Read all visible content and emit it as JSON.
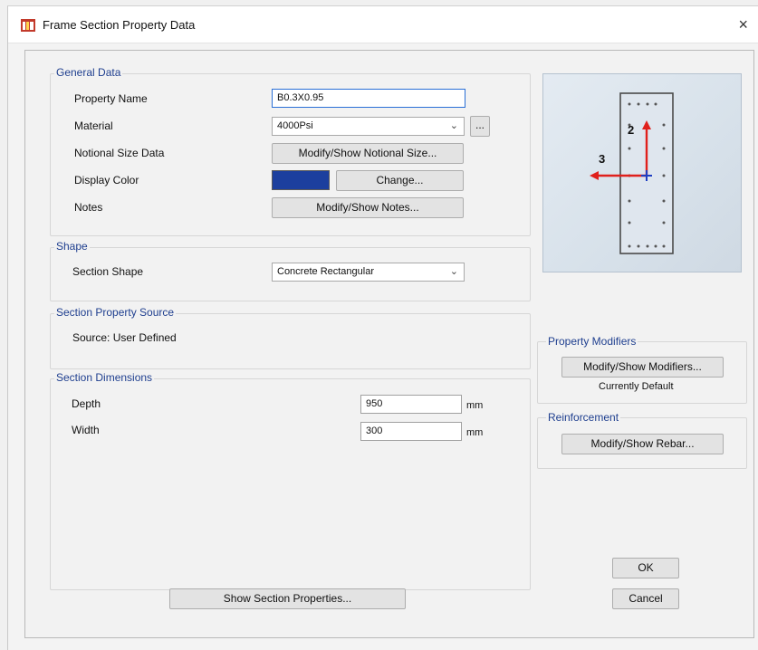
{
  "window": {
    "title": "Frame Section Property Data",
    "close_glyph": "×"
  },
  "general": {
    "title": "General Data",
    "property_name_label": "Property Name",
    "property_name_value": "B0.3X0.95",
    "material_label": "Material",
    "material_value": "4000Psi",
    "material_more_button": "...",
    "notional_label": "Notional Size Data",
    "notional_button": "Modify/Show Notional Size...",
    "display_color_label": "Display Color",
    "display_color_value": "#1c3f9e",
    "change_button": "Change...",
    "notes_label": "Notes",
    "notes_button": "Modify/Show Notes..."
  },
  "shape": {
    "title": "Shape",
    "section_shape_label": "Section Shape",
    "section_shape_value": "Concrete Rectangular"
  },
  "source": {
    "title": "Section Property Source",
    "text": "Source:  User Defined"
  },
  "dimensions": {
    "title": "Section Dimensions",
    "depth_label": "Depth",
    "depth_value": "950",
    "width_label": "Width",
    "width_value": "300",
    "unit": "mm"
  },
  "preview": {
    "axis_2_label": "2",
    "axis_3_label": "3",
    "axis_2_color": "#e0201c",
    "axis_3_color": "#e0201c",
    "origin_color": "#1f3fc2"
  },
  "modifiers": {
    "title": "Property Modifiers",
    "button": "Modify/Show Modifiers...",
    "status": "Currently Default"
  },
  "reinforcement": {
    "title": "Reinforcement",
    "button": "Modify/Show Rebar..."
  },
  "actions": {
    "show_properties": "Show Section Properties...",
    "ok": "OK",
    "cancel": "Cancel"
  }
}
